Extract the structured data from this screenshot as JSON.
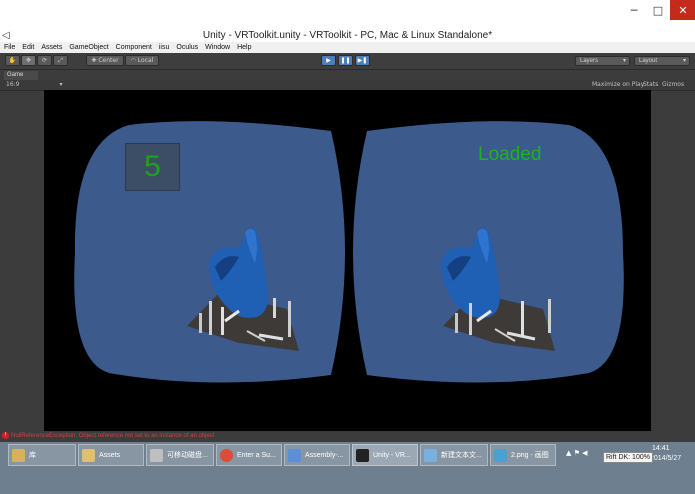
{
  "window": {
    "title": "Unity - VRToolkit.unity - VRToolkit - PC, Mac & Linux Standalone*",
    "controls": [
      "─",
      "□",
      "✕"
    ]
  },
  "menu": [
    "File",
    "Edit",
    "Assets",
    "GameObject",
    "Component",
    "iisu",
    "Oculus",
    "Window",
    "Help"
  ],
  "toolbar": {
    "transform_tools": [
      "✋",
      "✥",
      "⟳",
      "⤢"
    ],
    "pivot": "Center",
    "space": "Local",
    "playback": [
      "▶",
      "❚❚",
      "▶❚"
    ],
    "layers_label": "Layers",
    "layout_label": "Layout"
  },
  "game_panel": {
    "tab_label": "Game",
    "aspect": "16:9",
    "maximize_on_play": "Maximize on Play",
    "stats": "Stats",
    "gizmos": "Gizmos"
  },
  "scene": {
    "counter_value": "5",
    "status_text": "Loaded",
    "viewport_color": "#3c5a8c",
    "object_color": "#1f5fb4",
    "platform_color": "#3d3a38"
  },
  "status_bar": {
    "message": "NullReferenceException: Object reference not set to an instance of an object"
  },
  "taskbar": {
    "items": [
      {
        "label": "库",
        "color": "#d8b25a"
      },
      {
        "label": "Assets",
        "color": "#e0c070"
      },
      {
        "label": "可移动磁盘...",
        "color": "#bfbfbf"
      },
      {
        "label": "Enter a Su...",
        "color": "#dd4b39"
      },
      {
        "label": "Assembly-...",
        "color": "#5b8fd6"
      },
      {
        "label": "Unity - VR...",
        "color": "#222222"
      },
      {
        "label": "新建文本文...",
        "color": "#7ab0e0"
      },
      {
        "label": "2.png - 画图",
        "color": "#4aa0d0"
      }
    ],
    "tray_icons": "▲ ⚑ ◀",
    "time": "14:41",
    "date": "2014/5/27",
    "tooltip": "Rift DK: 100%"
  }
}
